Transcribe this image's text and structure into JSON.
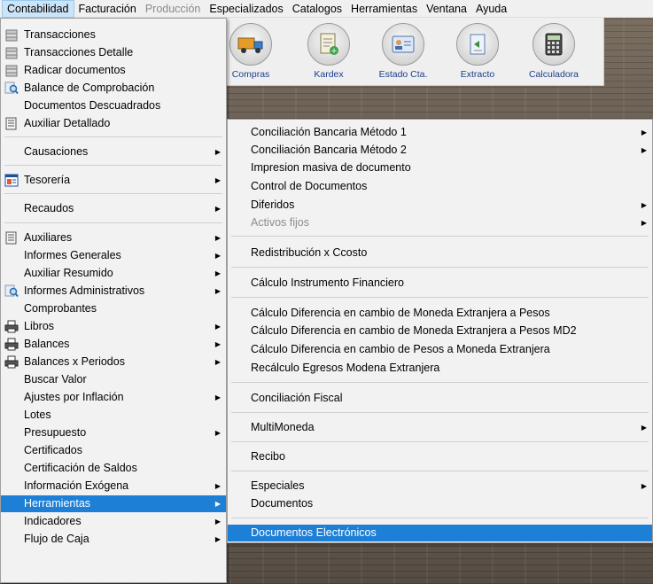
{
  "menubar": {
    "items": [
      {
        "label": "Contabilidad",
        "state": "active"
      },
      {
        "label": "Facturación",
        "state": "normal"
      },
      {
        "label": "Producción",
        "state": "disabled"
      },
      {
        "label": "Especializados",
        "state": "normal"
      },
      {
        "label": "Catalogos",
        "state": "normal"
      },
      {
        "label": "Herramientas",
        "state": "normal"
      },
      {
        "label": "Ventana",
        "state": "normal"
      },
      {
        "label": "Ayuda",
        "state": "normal"
      }
    ]
  },
  "toolbar": {
    "buttons": [
      {
        "label": "Compras",
        "icon": "truck-icon"
      },
      {
        "label": "Kardex",
        "icon": "kardex-icon"
      },
      {
        "label": "Estado Cta.",
        "icon": "id-card-icon"
      },
      {
        "label": "Extracto",
        "icon": "document-arrow-icon"
      },
      {
        "label": "Calculadora",
        "icon": "calculator-icon"
      }
    ]
  },
  "contabilidad_menu": {
    "items": [
      {
        "label": "Transacciones",
        "icon": "stack-icon"
      },
      {
        "label": "Transacciones Detalle",
        "icon": "stack-icon"
      },
      {
        "label": "Radicar documentos",
        "icon": "stack-icon"
      },
      {
        "label": "Balance de Comprobación",
        "icon": "magnifier-icon"
      },
      {
        "label": "Documentos Descuadrados",
        "icon": ""
      },
      {
        "label": "Auxiliar Detallado",
        "icon": "ledger-icon"
      },
      {
        "label": "Causaciones",
        "icon": "",
        "submenu": true
      },
      {
        "label": "Tesorería",
        "icon": "window-icon",
        "submenu": true
      },
      {
        "label": "Recaudos",
        "icon": "",
        "submenu": true
      },
      {
        "label": "Auxiliares",
        "icon": "ledger-icon",
        "submenu": true
      },
      {
        "label": "Informes Generales",
        "icon": "",
        "submenu": true
      },
      {
        "label": "Auxiliar Resumido",
        "icon": "",
        "submenu": true
      },
      {
        "label": "Informes Administrativos",
        "icon": "magnifier-icon",
        "submenu": true
      },
      {
        "label": "Comprobantes",
        "icon": ""
      },
      {
        "label": "Libros",
        "icon": "printer-icon",
        "submenu": true
      },
      {
        "label": "Balances",
        "icon": "printer-icon",
        "submenu": true
      },
      {
        "label": "Balances x Periodos",
        "icon": "printer-icon",
        "submenu": true
      },
      {
        "label": "Buscar Valor",
        "icon": ""
      },
      {
        "label": "Ajustes por Inflación",
        "icon": "",
        "submenu": true
      },
      {
        "label": "Lotes",
        "icon": ""
      },
      {
        "label": "Presupuesto",
        "icon": "",
        "submenu": true
      },
      {
        "label": "Certificados",
        "icon": ""
      },
      {
        "label": "Certificación de Saldos",
        "icon": ""
      },
      {
        "label": "Información Exógena",
        "icon": "",
        "submenu": true
      },
      {
        "label": "Herramientas",
        "icon": "",
        "submenu": true,
        "highlighted": true
      },
      {
        "label": "Indicadores",
        "icon": "",
        "submenu": true
      },
      {
        "label": "Flujo de Caja",
        "icon": "",
        "submenu": true
      }
    ]
  },
  "herramientas_menu": {
    "items": [
      {
        "label": "Conciliación Bancaria  Método 1",
        "submenu": true
      },
      {
        "label": "Conciliación Bancaria Método 2",
        "submenu": true
      },
      {
        "label": "Impresion masiva de documento"
      },
      {
        "label": "Control de Documentos"
      },
      {
        "label": "Diferidos",
        "submenu": true
      },
      {
        "label": "Activos fijos",
        "submenu": true,
        "disabled": true
      },
      {
        "label": "Redistribución x Ccosto"
      },
      {
        "label": "Cálculo Instrumento Financiero"
      },
      {
        "label": "Cálculo Diferencia en cambio de Moneda Extranjera a Pesos"
      },
      {
        "label": "Cálculo Diferencia en cambio de Moneda Extranjera a Pesos MD2"
      },
      {
        "label": "Cálculo Diferencia en cambio de Pesos a Moneda Extranjera"
      },
      {
        "label": "Recálculo Egresos Modena Extranjera"
      },
      {
        "label": "Conciliación Fiscal"
      },
      {
        "label": "MultiMoneda",
        "submenu": true
      },
      {
        "label": "Recibo"
      },
      {
        "label": "Especiales",
        "submenu": true
      },
      {
        "label": "Documentos"
      },
      {
        "label": "Documentos Electrónicos",
        "highlighted": true
      }
    ]
  },
  "colors": {
    "highlight": "#1e7fd6",
    "menubar_active": "#cce4f7",
    "toolbar_label": "#1c3d8f"
  }
}
